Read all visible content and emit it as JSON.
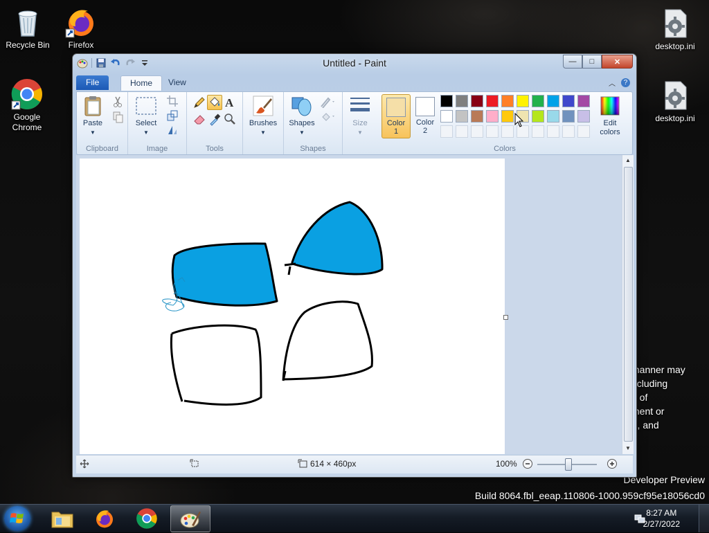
{
  "desktop": {
    "icons": [
      {
        "label": "Recycle Bin"
      },
      {
        "label": "Firefox"
      },
      {
        "label": "Google Chrome"
      },
      {
        "label": "desktop.ini"
      },
      {
        "label": "desktop.ini"
      }
    ],
    "watermark": {
      "partial_lines": [
        "manner may",
        "ncluding",
        "e of",
        "ment or",
        "f), and"
      ],
      "preview": "Developer Preview",
      "build": "Build 8064.fbl_eeap.110806-1000.959cf95e18056cd0"
    }
  },
  "window": {
    "title": "Untitled - Paint",
    "quick_access": [
      "paint-menu-icon",
      "save-icon",
      "undo-icon",
      "redo-icon",
      "customize-icon"
    ],
    "controls": {
      "minimize": "—",
      "maximize": "□",
      "close": "✕"
    }
  },
  "ribbon": {
    "tabs": [
      "File",
      "Home",
      "View"
    ],
    "active_tab": "Home",
    "groups": {
      "clipboard": {
        "label": "Clipboard",
        "paste": "Paste"
      },
      "image": {
        "label": "Image",
        "select": "Select"
      },
      "tools": {
        "label": "Tools"
      },
      "brushes": {
        "label": "Brushes"
      },
      "shapes": {
        "label": "Shapes"
      },
      "size": {
        "label": "Size"
      },
      "colors": {
        "label": "Colors",
        "color1": {
          "label": "Color",
          "num": "1",
          "value": "#f5dfa8"
        },
        "color2": {
          "label": "Color",
          "num": "2",
          "value": "#ffffff"
        },
        "edit": "Edit colors",
        "palette_row1": [
          "#000000",
          "#7f7f7f",
          "#880015",
          "#ed1c24",
          "#ff7f27",
          "#fff200",
          "#22b14c",
          "#00a2e8",
          "#3f48cc",
          "#a349a4"
        ],
        "palette_row2": [
          "#ffffff",
          "#c3c3c3",
          "#b97a57",
          "#ffaec9",
          "#ffc90e",
          "#efe4b0",
          "#b5e61d",
          "#99d9ea",
          "#7092be",
          "#c8bfe7"
        ]
      }
    }
  },
  "canvas": {
    "fill_color": "#0aa0e2",
    "outline_color": "#000000"
  },
  "status": {
    "dimensions": "614 × 460px",
    "zoom": "100%"
  },
  "taskbar": {
    "apps": [
      "windows-explorer-icon",
      "firefox-icon",
      "chrome-icon",
      "paint-icon"
    ],
    "active_app": "paint-icon",
    "time": "8:27 AM",
    "date": "2/27/2022"
  }
}
